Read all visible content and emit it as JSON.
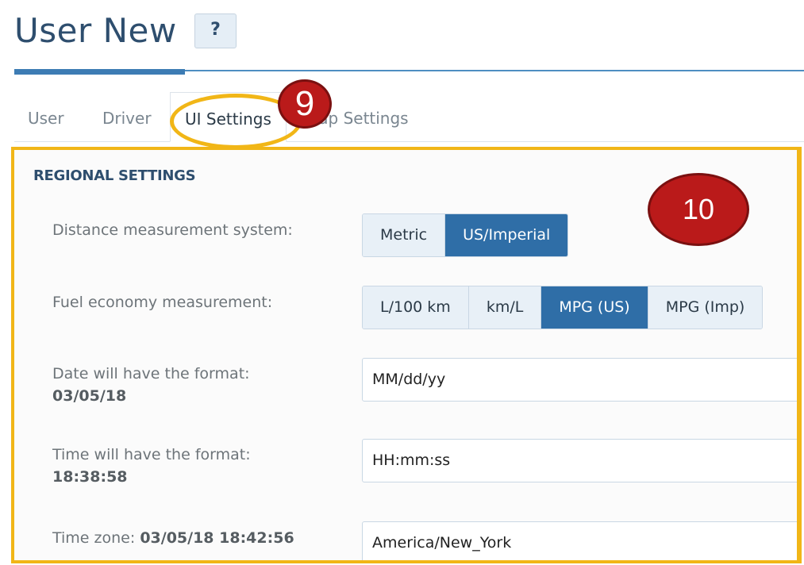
{
  "page": {
    "title": "User New",
    "help_label": "?"
  },
  "tabs": [
    {
      "label": "User"
    },
    {
      "label": "Driver"
    },
    {
      "label": "UI Settings",
      "active": true
    },
    {
      "label": "Map Settings"
    }
  ],
  "callouts": {
    "tab_marker": "9",
    "panel_marker": "10",
    "ring_color": "#f1b617",
    "badge_color": "#ba1a1a"
  },
  "regional": {
    "title": "REGIONAL SETTINGS",
    "distance": {
      "label": "Distance measurement system:",
      "options": [
        "Metric",
        "US/Imperial"
      ],
      "selected": "US/Imperial"
    },
    "fuel": {
      "label": "Fuel economy measurement:",
      "options": [
        "L/100 km",
        "km/L",
        "MPG (US)",
        "MPG (Imp)"
      ],
      "selected": "MPG (US)"
    },
    "date": {
      "label": "Date will have the format:",
      "example": "03/05/18",
      "value": "MM/dd/yy"
    },
    "time": {
      "label": "Time will have the format:",
      "example": "18:38:58",
      "value": "HH:mm:ss"
    },
    "timezone": {
      "label": "Time zone:",
      "current": "03/05/18 18:42:56",
      "value": "America/New_York"
    }
  },
  "colors": {
    "accent": "#2f6ea7",
    "title": "#2e4e6e"
  }
}
